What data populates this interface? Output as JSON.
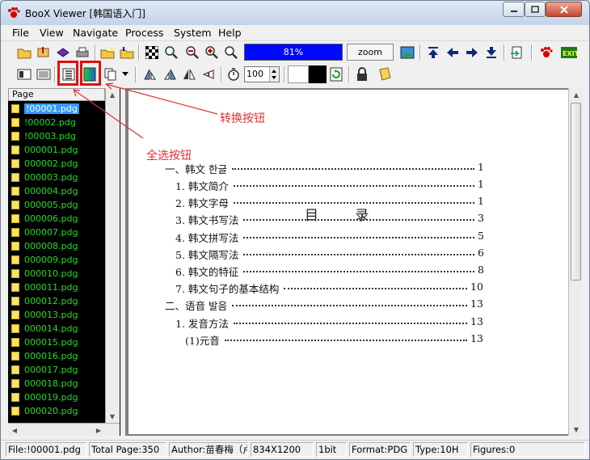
{
  "window": {
    "title": "BooX Viewer [韩国语入门]"
  },
  "menu": [
    "File",
    "View",
    "Navigate",
    "Process",
    "System",
    "Help"
  ],
  "toolbar": {
    "zoom_percent": "81%",
    "zoom_button": "zoom",
    "spin_value": "100"
  },
  "sidebar": {
    "header": "Page",
    "files": [
      "!00001.pdg",
      "!00002.pdg",
      "!00003.pdg",
      "000001.pdg",
      "000002.pdg",
      "000003.pdg",
      "000004.pdg",
      "000005.pdg",
      "000006.pdg",
      "000007.pdg",
      "000008.pdg",
      "000009.pdg",
      "000010.pdg",
      "000011.pdg",
      "000012.pdg",
      "000013.pdg",
      "000014.pdg",
      "000015.pdg",
      "000016.pdg",
      "000017.pdg",
      "000018.pdg",
      "000019.pdg",
      "000020.pdg"
    ],
    "selected_index": 0
  },
  "document": {
    "title": "目 录",
    "toc": [
      {
        "text": "一、韩文  한글",
        "page": "1"
      },
      {
        "text": "1. 韩文简介",
        "page": "1"
      },
      {
        "text": "2. 韩文字母",
        "page": "1"
      },
      {
        "text": "3. 韩文书写法",
        "page": "3"
      },
      {
        "text": "4. 韩文拼写法",
        "page": "5"
      },
      {
        "text": "5. 韩文隔写法",
        "page": "6"
      },
      {
        "text": "6. 韩文的特征",
        "page": "8"
      },
      {
        "text": "7. 韩文句子的基本结构",
        "page": "10"
      },
      {
        "text": "二、语音  발음",
        "page": "13"
      },
      {
        "text": "1. 发音方法",
        "page": "13"
      },
      {
        "text": "(1)元音",
        "page": "13"
      }
    ]
  },
  "annotations": {
    "convert": "转换按钮",
    "select_all": "全选按钮"
  },
  "status": {
    "file": "File:!00001.pdg",
    "total": "Total Page:350",
    "author": "Author:苗春梅（卢",
    "size": "834X1200",
    "bits": "1bit",
    "format": "Format:PDG",
    "type": "Type:10H",
    "figures": "Figures:0"
  },
  "colors": {
    "accent_red": "#e01010",
    "file_green": "#22dd22",
    "zoom_blue": "#0008ff"
  }
}
